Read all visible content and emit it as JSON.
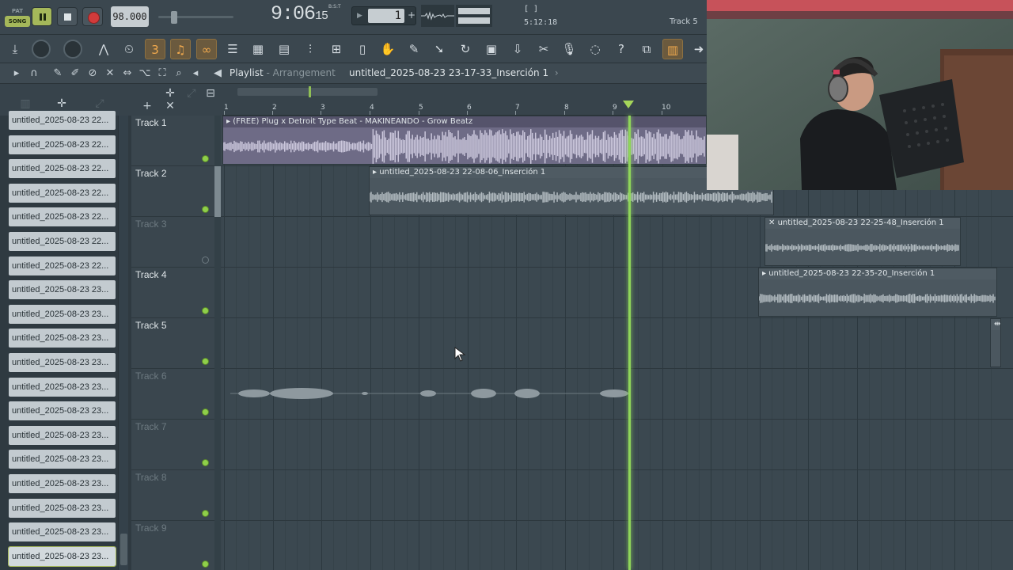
{
  "transport": {
    "pat_label": "PAT",
    "song_label": "SONG",
    "tempo": "98.000",
    "time_main": "9:06",
    "time_sub": "15",
    "time_label": "B:S:T",
    "pattern_number": "1",
    "hint_top": "[  ]",
    "hint_time": "5:12:18",
    "selected_track": "Track 5"
  },
  "playlist": {
    "title": "Playlist",
    "separator": " - ",
    "subtitle": "Arrangement",
    "project": "untitled_2025-08-23 23-17-33_Inserción 1",
    "project_arrow": "›"
  },
  "ruler": [
    "1",
    "2",
    "3",
    "4",
    "5",
    "6",
    "7",
    "8",
    "9",
    "10"
  ],
  "browser": {
    "items": [
      "untitled_2025-08-23 22...",
      "untitled_2025-08-23 22...",
      "untitled_2025-08-23 22...",
      "untitled_2025-08-23 22...",
      "untitled_2025-08-23 22...",
      "untitled_2025-08-23 22...",
      "untitled_2025-08-23 22...",
      "untitled_2025-08-23 23...",
      "untitled_2025-08-23 23...",
      "untitled_2025-08-23 23...",
      "untitled_2025-08-23 23...",
      "untitled_2025-08-23 23...",
      "untitled_2025-08-23 23...",
      "untitled_2025-08-23 23...",
      "untitled_2025-08-23 23...",
      "untitled_2025-08-23 23...",
      "untitled_2025-08-23 23...",
      "untitled_2025-08-23 23...",
      "untitled_2025-08-23 23..."
    ]
  },
  "tracks": [
    {
      "name": "Track 1",
      "active": true
    },
    {
      "name": "Track 2",
      "active": true
    },
    {
      "name": "Track 3",
      "active": false
    },
    {
      "name": "Track 4",
      "active": true
    },
    {
      "name": "Track 5",
      "active": true
    },
    {
      "name": "Track 6",
      "active": true
    },
    {
      "name": "Track 7",
      "active": true
    },
    {
      "name": "Track 8",
      "active": true
    },
    {
      "name": "Track 9",
      "active": true
    }
  ],
  "clips": {
    "beat": "(FREE) Plug x Detroit Type Beat - MAKINEANDO - Grow Beatz",
    "clip2": "untitled_2025-08-23 22-08-06_Inserción 1",
    "clip3": "untitled_2025-08-23 22-25-48_Inserción 1",
    "clip4": "untitled_2025-08-23 22-35-20_Inserción 1"
  },
  "icons": {
    "play": "pause-icon",
    "stop": "stop-icon",
    "record": "record-icon",
    "toolbar": [
      "download-icon",
      "master-volume-knob",
      "master-pitch-knob",
      "metronome-icon",
      "wait-icon",
      "countdown-icon",
      "blend-notes-icon",
      "loop-record-icon",
      "mixer-icon",
      "channel-rack-icon",
      "piano-roll-icon",
      "browser-icon",
      "plugin-picker-icon",
      "project-icon",
      "touch-icon",
      "cut-icon",
      "save-icon",
      "microphone-icon",
      "chat-icon",
      "help-icon",
      "window-icon",
      "keyboard-icon",
      "arrow-icon"
    ]
  },
  "colors": {
    "accent_green": "#8fd65a",
    "song_badge": "#a5b85a",
    "record_red": "#d23b3b",
    "beat_clip": "#6e6b86",
    "audio_clip": "#4b575f"
  }
}
